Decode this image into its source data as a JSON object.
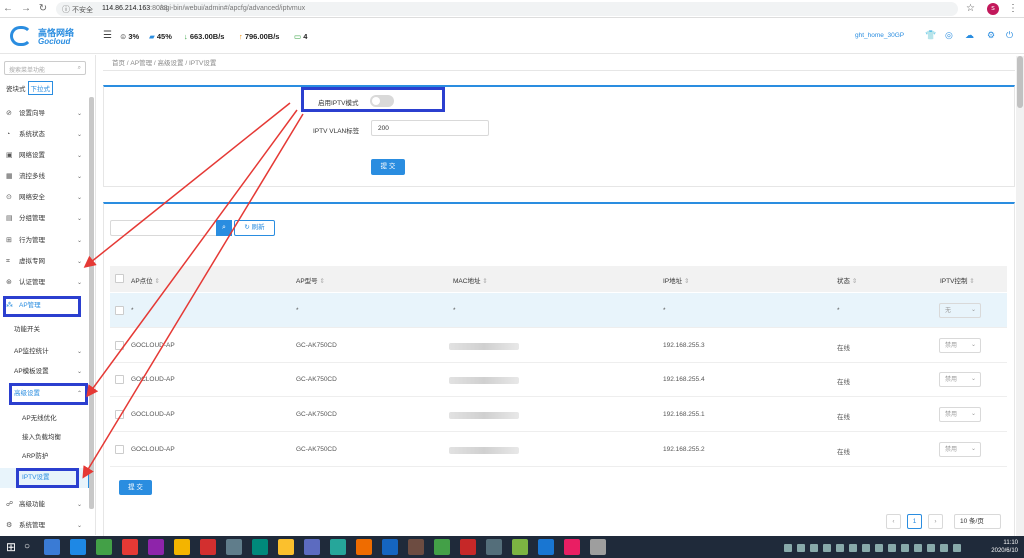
{
  "browser": {
    "security": "不安全",
    "host": "114.86.214.163",
    "port": ":8088",
    "path": "/cgi-bin/webui/admin#/apcfg/advanced/iptvmux"
  },
  "logo": {
    "cn": "高恪网络",
    "en": "Gocloud"
  },
  "header": {
    "cpu": "3%",
    "mem": "45%",
    "down": "663.00B/s",
    "up": "796.00B/s",
    "devices": "4",
    "user": "ght_home_30GP"
  },
  "sidebar": {
    "search_placeholder": "搜索菜单功能",
    "mode_tile": "瓷块式",
    "mode_dropdown": "下拉式",
    "items": [
      {
        "label": "设置向导",
        "icon": "compass-icon"
      },
      {
        "label": "系统状态",
        "icon": "status-icon"
      },
      {
        "label": "网络设置",
        "icon": "network-icon"
      },
      {
        "label": "流控多线",
        "icon": "flow-icon"
      },
      {
        "label": "网络安全",
        "icon": "shield-icon"
      },
      {
        "label": "分组管理",
        "icon": "group-icon"
      },
      {
        "label": "行为管理",
        "icon": "behavior-icon"
      },
      {
        "label": "虚拟专网",
        "icon": "vpn-icon"
      },
      {
        "label": "认证管理",
        "icon": "auth-icon"
      },
      {
        "label": "AP管理",
        "icon": "ap-icon"
      }
    ],
    "ap_sub": [
      "功能开关",
      "AP监控统计",
      "AP模板设置",
      "高级设置"
    ],
    "adv_sub": [
      "AP无线优化",
      "接入负载均衡",
      "ARP防护",
      "IPTV设置"
    ],
    "bottom": [
      {
        "label": "高级功能",
        "icon": "advanced-icon"
      },
      {
        "label": "系统管理",
        "icon": "system-icon"
      }
    ]
  },
  "breadcrumb": [
    "首页",
    "AP管理",
    "高级设置",
    "IPTV设置"
  ],
  "form": {
    "iptv_label": "启用IPTV模式",
    "iptv_enabled": false,
    "vlan_label": "IPTV VLAN标签",
    "vlan_value": "200",
    "submit": "提 交"
  },
  "table": {
    "refresh": "刷新",
    "headers": [
      "AP点位",
      "AP型号",
      "MAC地址",
      "IP地址",
      "状态",
      "IPTV控制"
    ],
    "rows": [
      {
        "name": "*",
        "model": "*",
        "mac": "*",
        "ip": "*",
        "status": "*",
        "ctrl": "无"
      },
      {
        "name": "GOCLOUD-AP",
        "model": "GC-AK750CD",
        "mac": "",
        "ip": "192.168.255.3",
        "status": "在线",
        "ctrl": "禁用"
      },
      {
        "name": "GOCLOUD-AP",
        "model": "GC-AK750CD",
        "mac": "",
        "ip": "192.168.255.4",
        "status": "在线",
        "ctrl": "禁用"
      },
      {
        "name": "GOCLOUD-AP",
        "model": "GC-AK750CD",
        "mac": "",
        "ip": "192.168.255.1",
        "status": "在线",
        "ctrl": "禁用"
      },
      {
        "name": "GOCLOUD-AP",
        "model": "GC-AK750CD",
        "mac": "",
        "ip": "192.168.255.2",
        "status": "在线",
        "ctrl": "禁用"
      }
    ],
    "submit": "提 交",
    "page": "1",
    "page_size": "10 条/页"
  },
  "taskbar": {
    "time": "11:10",
    "date": "2020/6/10"
  },
  "colors": {
    "accent": "#2a8de0",
    "highlight": "#2b3fcf",
    "arrow": "#e53935"
  }
}
